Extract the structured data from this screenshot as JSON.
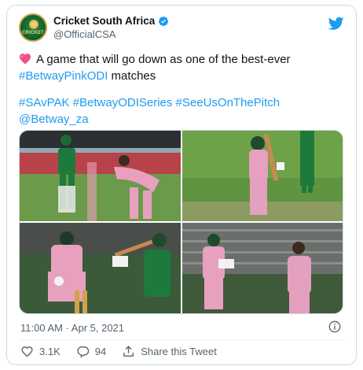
{
  "account": {
    "display_name": "Cricket South Africa",
    "handle": "@OfficialCSA",
    "avatar_text": "CRICKET"
  },
  "tweet": {
    "line1_text": "A game that will go down as one of the best-ever",
    "line2_hashtag": "#BetwayPinkODI",
    "line2_text": " matches",
    "hashtags": [
      "#SAvPAK",
      "#BetwayODISeries",
      "#SeeUsOnThePitch"
    ],
    "mention": "@Betway_za"
  },
  "meta": {
    "timestamp": "11:00 AM · Apr 5, 2021"
  },
  "actions": {
    "likes": "3.1K",
    "replies": "94",
    "share_label": "Share this Tweet"
  },
  "colors": {
    "link": "#1d9bf0",
    "heart": "#e0245e",
    "secondary_text": "#536471",
    "border": "#cfd9de",
    "pitch_green": "#4f8a3a",
    "pink_kit": "#e8a0bf",
    "sa_green": "#1e7a3c"
  },
  "icons": {
    "verified": "verified-badge-icon",
    "brand": "twitter-bird-icon",
    "heart_emoji": "pink-heart-emoji",
    "info": "info-icon",
    "like": "heart-icon",
    "reply": "reply-bubble-icon",
    "share": "share-upload-icon"
  }
}
